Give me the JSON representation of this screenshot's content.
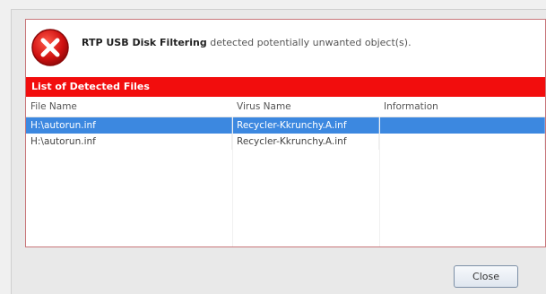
{
  "dialog": {
    "product_name": "RTP USB Disk Filtering",
    "message_rest": " detected potentially unwanted object(s).",
    "section_title": "List of Detected Files",
    "icon": "error-x-icon"
  },
  "table": {
    "columns": [
      "File Name",
      "Virus Name",
      "Information"
    ],
    "rows": [
      {
        "file": "H:\\autorun.inf",
        "virus": "Recycler-Kkrunchy.A.inf",
        "info": ""
      },
      {
        "file": "H:\\autorun.inf",
        "virus": "Recycler-Kkrunchy.A.inf",
        "info": ""
      }
    ],
    "selected_row": 0
  },
  "buttons": {
    "close_label": "Close"
  },
  "colors": {
    "accent_red": "#f20d0d",
    "selection_blue": "#3c88e0"
  }
}
